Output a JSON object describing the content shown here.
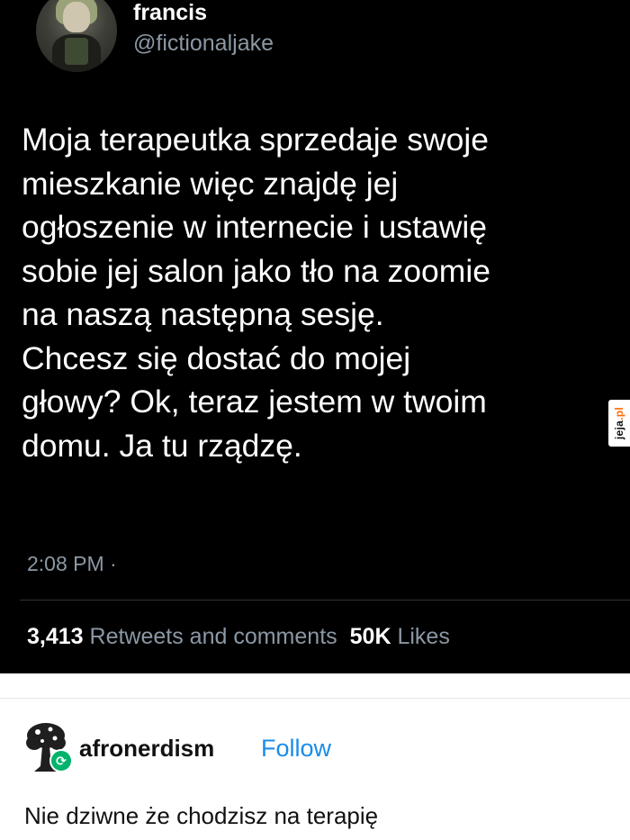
{
  "tweet": {
    "display_name": "francis",
    "handle": "@fictionaljake",
    "text": "Moja terapeutka sprzedaje swoje\nmieszkanie więc znajdę jej\nogłoszenie w internecie i ustawię\nsobie jej salon jako tło na zoomie\nna naszą następną sesję.\nChcesz się dostać do mojej\ngłowy? Ok, teraz jestem w twoim\ndomu. Ja tu rządzę.",
    "timestamp": "2:08 PM ·",
    "retweets_count": "3,413",
    "retweets_label": "Retweets and comments",
    "likes_count": "50K",
    "likes_label": "Likes"
  },
  "watermark": {
    "text_main": "jeja",
    "text_suffix": ".pl"
  },
  "post": {
    "username": "afronerdism",
    "follow_label": "Follow",
    "reply_text": "Nie dziwne że chodzisz na terapię"
  },
  "colors": {
    "tweet_background": "#000000",
    "muted_text": "#8b98a5",
    "follow_blue": "#1a8ce8",
    "reblog_green": "#00b36b"
  },
  "icons": {
    "avatar": "profile-photo",
    "post_avatar": "tree-icon",
    "reblog": "reblog-icon"
  }
}
